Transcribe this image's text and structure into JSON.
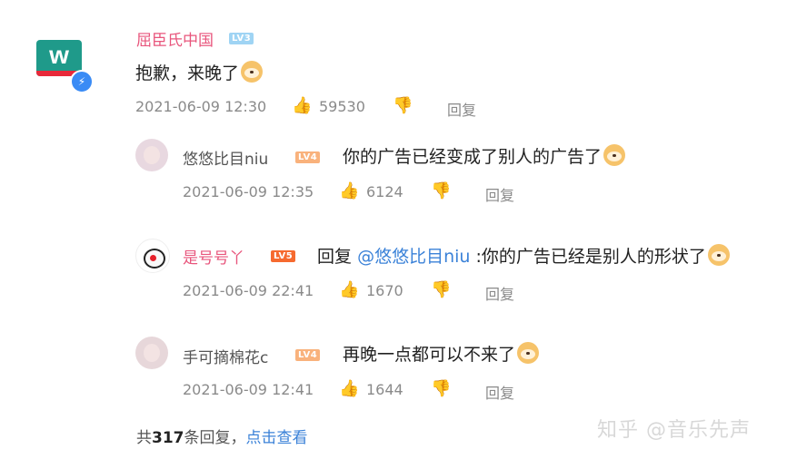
{
  "main_comment": {
    "author": "屈臣氏中国",
    "level": "LV3",
    "text": "抱歉，来晚了",
    "emoji": "doge-emoji",
    "time": "2021-06-09 12:30",
    "likes": "59530",
    "reply_label": "回复",
    "avatar_letter": "w",
    "verified_icon": "⚡"
  },
  "replies": [
    {
      "author": "悠悠比目niu",
      "level": "LV4",
      "text": "你的广告已经变成了别人的广告了",
      "time": "2021-06-09 12:35",
      "likes": "6124",
      "reply_label": "回复"
    },
    {
      "author": "是号号丫",
      "level": "LV5",
      "text_prefix": "回复",
      "mention": "@悠悠比目niu",
      "text": ":你的广告已经是别人的形状了",
      "time": "2021-06-09 22:41",
      "likes": "1670",
      "reply_label": "回复"
    },
    {
      "author": "手可摘棉花c",
      "level": "LV4",
      "text": "再晚一点都可以不来了",
      "time": "2021-06-09 12:41",
      "likes": "1644",
      "reply_label": "回复"
    }
  ],
  "footer": {
    "prefix": "共",
    "count": "317",
    "suffix": "条回复，",
    "link": "点击查看"
  },
  "watermark": "知乎 @音乐先声",
  "colors": {
    "pink_name": "#e8557c",
    "link_blue": "#3b82d8",
    "meta_gray": "#8a8a8a"
  }
}
